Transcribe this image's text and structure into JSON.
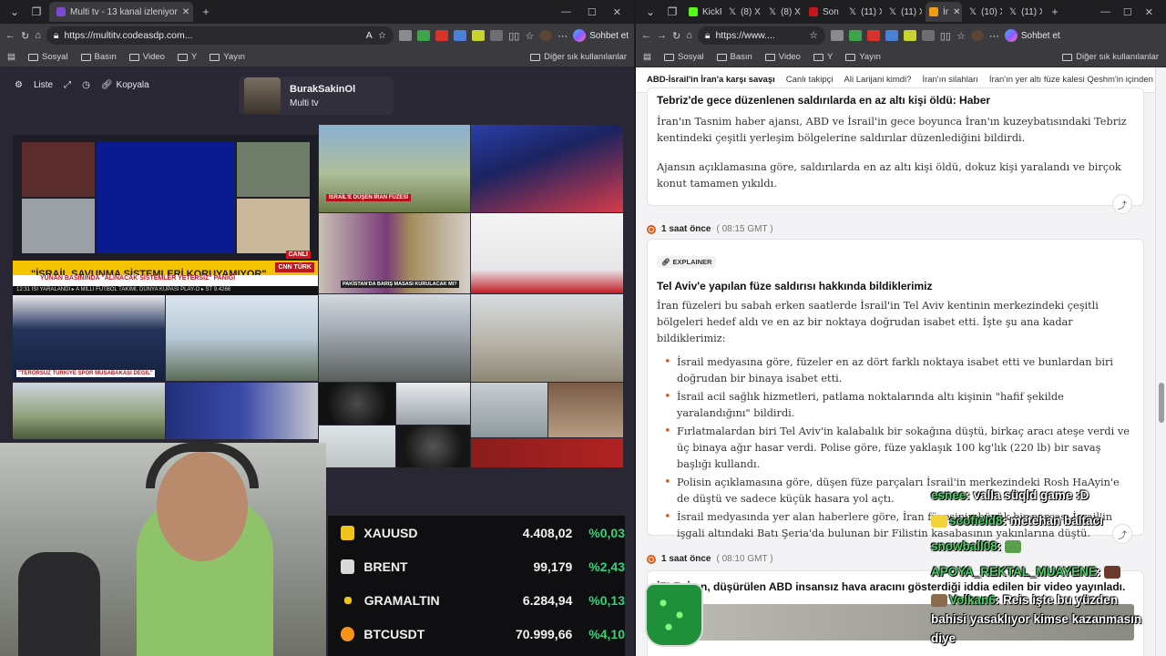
{
  "left_window": {
    "tabs": [
      {
        "title": "Multi tv - 13 kanal izleniyor",
        "active": true
      }
    ],
    "url": "https://multitv.codeasdp.com...",
    "copilot_label": "Sohbet et",
    "bookmarks": [
      "Sosyal",
      "Basın",
      "Video",
      "Y",
      "Yayın"
    ],
    "bookmarks_other": "Diğer sık kullanılanlar",
    "controls": {
      "list": "Liste",
      "copy": "Kopyala"
    },
    "profile": {
      "name": "BurakSakinOl",
      "subtitle": "Multi tv"
    },
    "news_banner": "\"İSRAİL SAVUNMA SİSTEMLERİ KORUYAMIYOR\"",
    "news_sub": "YUNAN BASININDA \"ALINACAK SİSTEMLER YETERSİZ\" PANİĞİ",
    "news_ticker": "12:31 İSİ YARALANDI  ▸  A MİLLİ FUTBOL TAKIMI, DÜNYA KUPASI PLAY-O  ▸  ST 9.4266",
    "channel_logo": "CNN TÜRK",
    "live_label": "CANLI",
    "lower_third_1": "\"TERÖRSÜZ TÜRKİYE SPOR MÜSABAKASI DEĞİL\"",
    "lower_third_2": "İSRAİL'E DÜŞEN İRAN FÜZESİ",
    "lower_third_3": "PAKİSTAN'DA BARIŞ MASASI KURULACAK MI?",
    "prices": [
      {
        "name": "XAUUSD",
        "value": "4.408,02",
        "change": "%0,03",
        "color": "#f0c419"
      },
      {
        "name": "BRENT",
        "value": "99,179",
        "change": "%2,43",
        "color": "#d9d9d9"
      },
      {
        "name": "GRAMALTIN",
        "value": "6.284,94",
        "change": "%0,13",
        "color": "#f0c419"
      },
      {
        "name": "BTCUSDT",
        "value": "70.999,66",
        "change": "%4,10",
        "color": "#f7931a"
      }
    ]
  },
  "right_window": {
    "url": "https://www....",
    "copilot_label": "Sohbet et",
    "tabs": [
      "KickP",
      "(8) X",
      "(8) X",
      "Son d",
      "(11) X",
      "(11) X",
      "İr",
      "(10) X",
      "(11) X"
    ],
    "bookmarks": [
      "Sosyal",
      "Basın",
      "Video",
      "Y",
      "Yayın"
    ],
    "bookmarks_other": "Diğer sık kullanılanlar",
    "topic_nav": [
      "ABD-İsrail'in İran'a karşı savaşı",
      "Canlı takipçi",
      "Ali Larijani kimdi?",
      "İran'ın silahları",
      "İran'ın yer altı füze kalesi Qeshm'in içinden g"
    ],
    "card1": {
      "title": "Tebriz'de gece düzenlenen saldırılarda en az altı kişi öldü: Haber",
      "p1": "İran'ın Tasnim haber ajansı, ABD ve İsrail'in gece boyunca İran'ın kuzeybatısındaki Tebriz kentindeki çeşitli yerleşim bölgelerine saldırılar düzenlediğini bildirdi.",
      "p2": "Ajansın açıklamasına göre, saldırılarda en az altı kişi öldü, dokuz kişi yaralandı ve birçok konut tamamen yıkıldı."
    },
    "time1": {
      "ago": "1 saat önce",
      "gmt": "( 08:15 GMT )"
    },
    "card2": {
      "badge": "EXPLAINER",
      "title": "Tel Aviv'e yapılan füze saldırısı hakkında bildiklerimiz",
      "intro": "İran füzeleri bu sabah erken saatlerde İsrail'in Tel Aviv kentinin merkezindeki çeşitli bölgeleri hedef aldı ve en az bir noktaya doğrudan isabet etti. İşte şu ana kadar bildiklerimiz:",
      "bullets": [
        "İsrail medyasına göre, füzeler en az dört farklı noktaya isabet etti ve bunlardan biri doğrudan bir binaya isabet etti.",
        "İsrail acil sağlık hizmetleri, patlama noktalarında altı kişinin \"hafif şekilde yaralandığını\" bildirdi.",
        "Fırlatmalardan biri Tel Aviv'in kalabalık bir sokağına düştü, birkaç aracı ateşe verdi ve üç binaya ağır hasar verdi. Polise göre, füze yaklaşık 100 kg'lık (220 lb) bir savaş başlığı kullandı.",
        "Polisin açıklamasına göre, düşen füze parçaları İsrail'in merkezindeki Rosh HaAyin'e de düştü ve sadece küçük hasara yol açtı.",
        "İsrail medyasında yer alan haberlere göre, İran füzesinin büyük bir parçası İsrail'in işgali altındaki Batı Şeria'da bulunan bir Filistin kasabasının yakınlarına düştü."
      ]
    },
    "time2": {
      "ago": "1 saat önce",
      "gmt": "( 08:10 GMT )"
    },
    "card3": {
      "title": "İZLE: İran, düşürülen ABD insansız hava aracını gösterdiği iddia edilen bir video yayınladı."
    }
  },
  "chat": [
    {
      "user": "esnee",
      "text": "valla süqld game :D"
    },
    {
      "user": "scofield8",
      "text": "metehan baltacı"
    },
    {
      "user": "snowball08",
      "text": ""
    },
    {
      "user": "APOYA_REKTAL_MUAYENE",
      "text": ""
    },
    {
      "user": "Volkan6",
      "text": "Reis işte bu yüzden bahisi yasaklıyor kimse kazanmasın diye"
    }
  ]
}
